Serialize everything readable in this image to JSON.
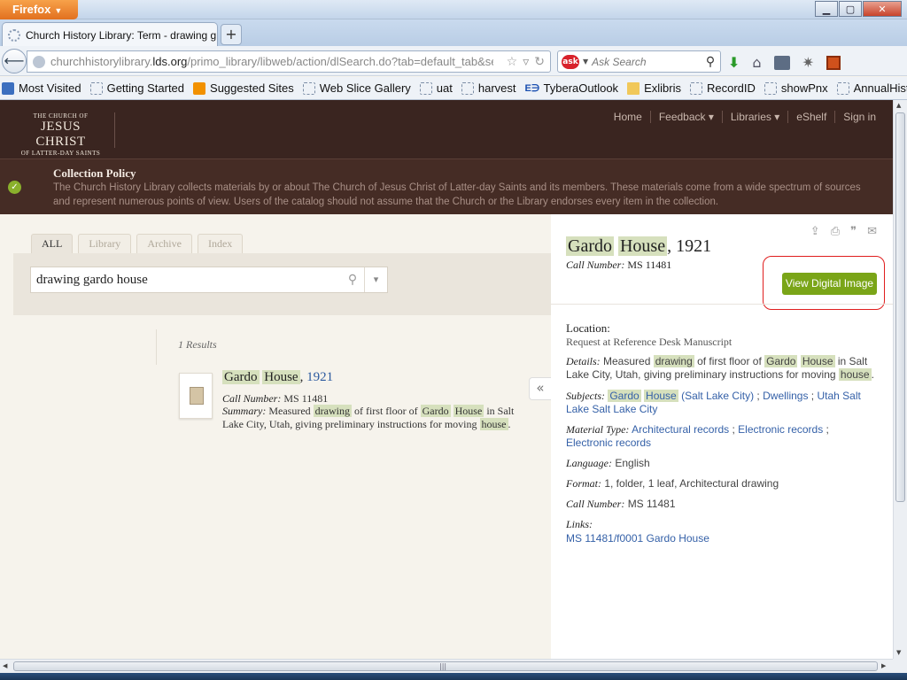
{
  "browser": {
    "menu_label": "Firefox",
    "tab_title": "Church History Library: Term - drawing g...",
    "new_tab_label": "+",
    "url_prefix": "churchhistorylibrary.",
    "url_domain": "lds.org",
    "url_path": "/primo_library/libweb/action/dlSearch.do?tab=default_tab&search_sc",
    "search_placeholder": "Ask Search",
    "bookmarks": [
      {
        "label": "Most Visited",
        "icon": "most-visited-icon"
      },
      {
        "label": "Getting Started",
        "icon": "page-icon"
      },
      {
        "label": "Suggested Sites",
        "icon": "suggested-sites-icon"
      },
      {
        "label": "Web Slice Gallery",
        "icon": "page-icon"
      },
      {
        "label": "uat",
        "icon": "page-icon"
      },
      {
        "label": "harvest",
        "icon": "page-icon"
      },
      {
        "label": "TyberaOutlook",
        "icon": "tybera-icon"
      },
      {
        "label": "Exlibris",
        "icon": "folder-icon"
      },
      {
        "label": "RecordID",
        "icon": "page-icon"
      },
      {
        "label": "showPnx",
        "icon": "page-icon"
      },
      {
        "label": "AnnualHistory",
        "icon": "page-icon"
      }
    ],
    "bookmarks_overflow": "»"
  },
  "site": {
    "logo": {
      "line1": "THE CHURCH OF",
      "line2": "JESUS CHRIST",
      "line3": "OF LATTER-DAY SAINTS"
    },
    "nav": {
      "home": "Home",
      "feedback": "Feedback ▾",
      "libraries": "Libraries ▾",
      "eshelf": "eShelf",
      "signin": "Sign in"
    },
    "policy": {
      "title": "Collection Policy",
      "text": "The Church History Library collects materials by or about The Church of Jesus Christ of Latter-day Saints and its members. These materials come from a wide spectrum of sources and represent numerous points of view. Users of the catalog should not assume that the Church or the Library endorses every item in the collection."
    }
  },
  "search": {
    "scopes": [
      "ALL",
      "Library",
      "Archive",
      "Index"
    ],
    "active_scope": "ALL",
    "query": "drawing gardo house",
    "results_count": "1 Results"
  },
  "result": {
    "title_word1": "Gardo",
    "title_word2": "House",
    "title_sep": ", ",
    "title_year": "1921",
    "call_label": "Call Number:",
    "call_value": "MS 11481",
    "summary_label": "Summary:",
    "summary_parts": [
      "Measured ",
      "drawing",
      " of first floor of ",
      "Gardo",
      " ",
      "House",
      " in Salt Lake City, Utah, giving preliminary instructions for moving ",
      "house",
      "."
    ]
  },
  "detail": {
    "title_word1": "Gardo",
    "title_word2": "House",
    "title_rest": ", 1921",
    "call_label": "Call Number:",
    "call_value": "MS 11481",
    "view_button": "View Digital Image",
    "location_label": "Location:",
    "location_value": "Request at Reference Desk Manuscript",
    "details_label": "Details:",
    "details_parts": [
      "Measured ",
      "drawing",
      " of first floor of ",
      "Gardo",
      " ",
      "House",
      " in Salt Lake City, Utah, giving preliminary instructions for moving ",
      "house",
      "."
    ],
    "subjects_label": "Subjects:",
    "subjects": {
      "w1": "Gardo",
      "w2": "House",
      "rest1": " (Salt Lake City)",
      "sep1": " ; ",
      "s2": "Dwellings",
      "sep2": " ; ",
      "s3": "Utah Salt Lake Salt Lake City"
    },
    "material_label": "Material Type:",
    "material": {
      "m1": "Architectural records",
      "sep": " ; ",
      "m2": "Electronic records",
      "m3": "Electronic records"
    },
    "language_label": "Language:",
    "language_value": "English",
    "format_label": "Format:",
    "format_value": "1, folder, 1 leaf, Architectural drawing",
    "call2_label": "Call Number:",
    "call2_value": "MS 11481",
    "links_label": "Links:",
    "link_value": "MS 11481/f0001 Gardo House"
  },
  "colors": {
    "header": "#3a2520",
    "policy": "#452c25",
    "accent_green": "#7aa518",
    "highlight": "#d6e0bd",
    "link": "#3561a8",
    "annotation": "#e01e1e"
  }
}
